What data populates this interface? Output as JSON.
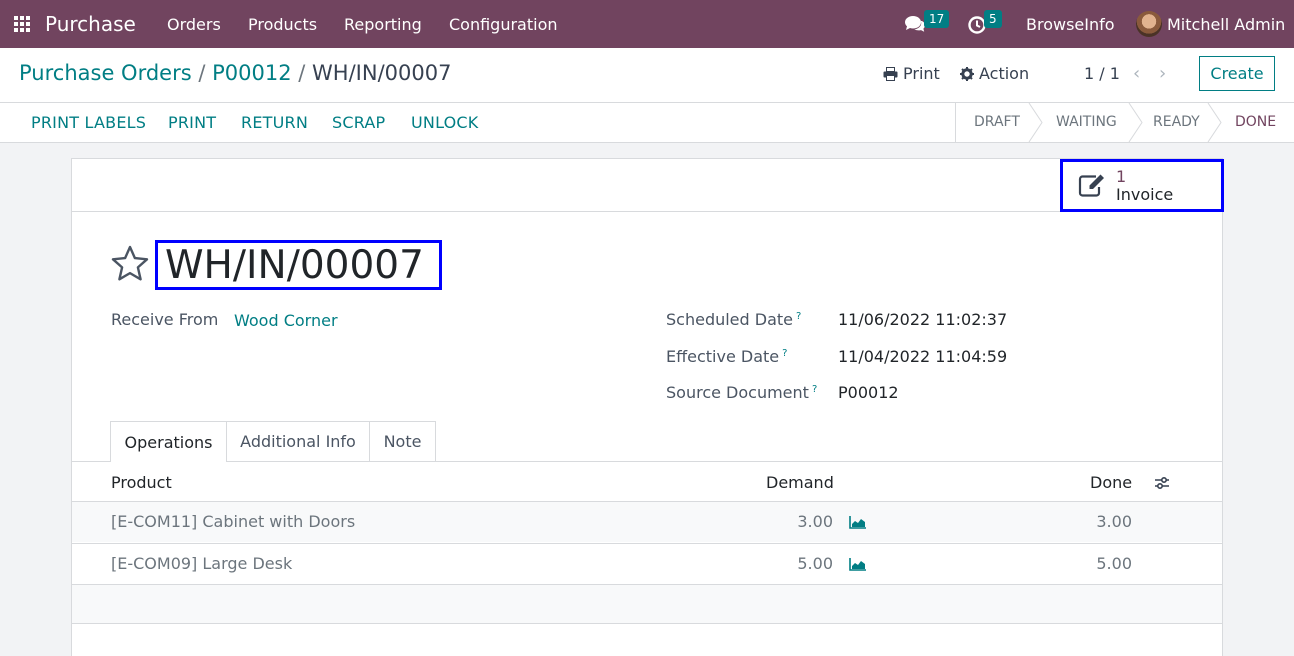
{
  "navbar": {
    "app_name": "Purchase",
    "menu": [
      "Orders",
      "Products",
      "Reporting",
      "Configuration"
    ],
    "messages_count": "17",
    "activities_count": "5",
    "company": "BrowseInfo",
    "user": "Mitchell Admin"
  },
  "breadcrumb": {
    "root": "Purchase Orders",
    "sep": "/",
    "parent": "P00012",
    "current": "WH/IN/00007"
  },
  "control": {
    "print_label": "Print",
    "action_label": "Action",
    "pager": "1 / 1",
    "create_label": "Create"
  },
  "actions": [
    "PRINT LABELS",
    "PRINT",
    "RETURN",
    "SCRAP",
    "UNLOCK"
  ],
  "statusbar": [
    "DRAFT",
    "WAITING",
    "READY",
    "DONE"
  ],
  "statusbar_active": "DONE",
  "smart_button": {
    "count": "1",
    "label": "Invoice"
  },
  "record": {
    "name": "WH/IN/00007",
    "receive_from_label": "Receive From",
    "receive_from": "Wood Corner",
    "scheduled_label": "Scheduled Date",
    "scheduled": "11/06/2022 11:02:37",
    "effective_label": "Effective Date",
    "effective": "11/04/2022 11:04:59",
    "source_label": "Source Document",
    "source": "P00012",
    "help_mark": "?"
  },
  "tabs": [
    "Operations",
    "Additional Info",
    "Note"
  ],
  "table": {
    "headers": {
      "product": "Product",
      "demand": "Demand",
      "done": "Done"
    },
    "rows": [
      {
        "product": "[E-COM11] Cabinet with Doors",
        "demand": "3.00",
        "done": "3.00"
      },
      {
        "product": "[E-COM09] Large Desk",
        "demand": "5.00",
        "done": "5.00"
      }
    ]
  },
  "colors": {
    "brand": "#71445f",
    "accent": "#017e84",
    "highlight": "#0000ff"
  },
  "icons": [
    "apps-grid-icon",
    "chat-icon",
    "clock-icon",
    "printer-icon",
    "gear-icon",
    "chevron-left-icon",
    "chevron-right-icon",
    "edit-invoice-icon",
    "star-icon",
    "area-chart-icon",
    "sliders-icon"
  ]
}
